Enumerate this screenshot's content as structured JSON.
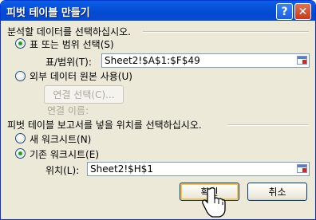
{
  "window": {
    "title": "피벗 테이블 만들기",
    "help_label": "?",
    "close_label": "✕"
  },
  "section1": {
    "heading": "분석할 데이터를 선택하십시오.",
    "option_range": "표 또는 범위 선택(S)",
    "range_label": "표/범위(T):",
    "range_value": "Sheet2!$A$1:$F$49",
    "option_external": "외부 데이터 원본 사용(U)",
    "choose_connection": "연결 선택(C)...",
    "connection_name_label": "연결 이름:"
  },
  "section2": {
    "heading": "피벗 테이블 보고서를 넣을 위치를 선택하십시오.",
    "option_new": "새 워크시트(N)",
    "option_existing": "기존 워크시트(E)",
    "location_label": "위치(L):",
    "location_value": "Sheet2!$H$1"
  },
  "buttons": {
    "ok": "확인",
    "cancel": "취소"
  },
  "colors": {
    "titlebar": "#0a5fe6",
    "dialog_bg": "#ece9d8",
    "radio_dot": "#21a121",
    "default_button_glow": "#f7c453"
  },
  "icons": {
    "range_picker": "range-picker-icon",
    "cursor": "hand-pointer-icon"
  }
}
